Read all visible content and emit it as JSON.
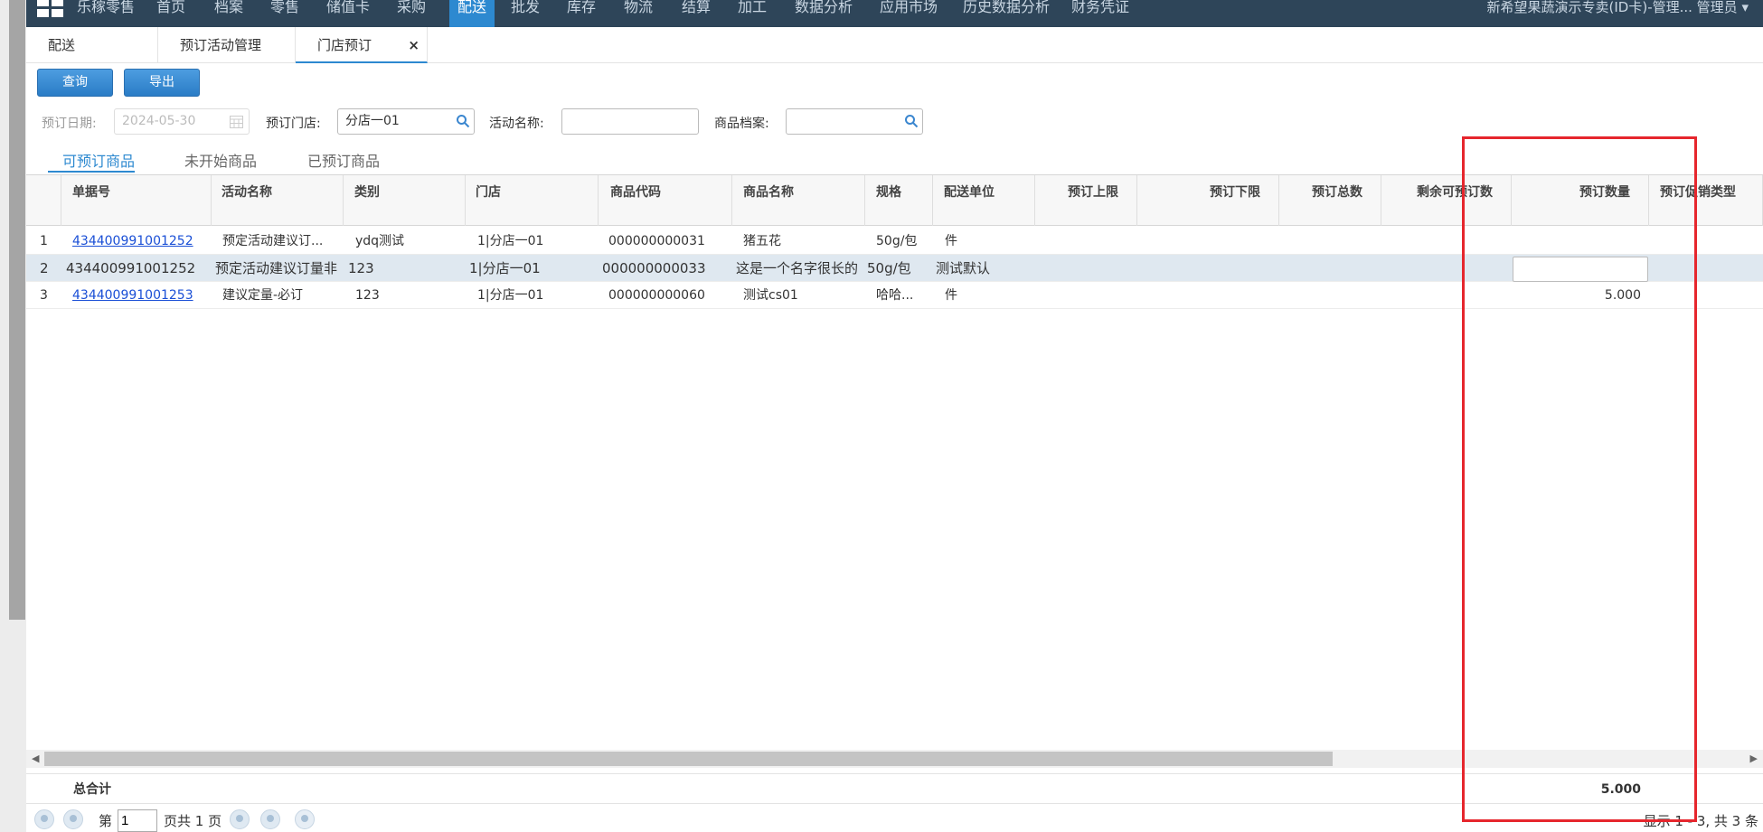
{
  "topnav": {
    "items": [
      "乐稼零售",
      "首页",
      "档案",
      "零售",
      "储值卡",
      "采购",
      "配送",
      "批发",
      "库存",
      "物流",
      "结算",
      "加工",
      "数据分析",
      "应用市场",
      "历史数据分析",
      "财务凭证"
    ],
    "active_index": 6,
    "user": "新希望果蔬演示专卖(ID卡)-管理...  管理员"
  },
  "tabs": [
    {
      "label": "配送"
    },
    {
      "label": "预订活动管理"
    },
    {
      "label": "门店预订",
      "close": "×"
    }
  ],
  "toolbar": {
    "query_label": "查询",
    "export_label": "导出"
  },
  "filters": {
    "date_label": "预订日期:",
    "date_value": "2024-05-30",
    "store_label": "预订门店:",
    "store_value": "分店一01",
    "activity_label": "活动名称:",
    "activity_value": "",
    "product_label": "商品档案:",
    "product_value": ""
  },
  "subtabs": [
    "可预订商品",
    "未开始商品",
    "已预订商品"
  ],
  "table": {
    "headers": [
      "单据号",
      "活动名称",
      "类别",
      "门店",
      "商品代码",
      "商品名称",
      "规格",
      "配送单位",
      "预订上限",
      "预订下限",
      "预订总数",
      "剩余可预订数",
      "预订数量",
      "预订促销类型"
    ],
    "rows": [
      {
        "num": "1",
        "doc": "434400991001252",
        "activity": "预定活动建议订...",
        "category": "ydq测试",
        "store": "1|分店一01",
        "code": "000000000031",
        "name": "猪五花",
        "spec": "50g/包",
        "unit": "件",
        "qty": ""
      },
      {
        "num": "2",
        "doc": "434400991001252",
        "activity": "预定活动建议订量非",
        "category": "123",
        "store": "1|分店一01",
        "code": "000000000033",
        "name": "这是一个名字很长的",
        "spec": "50g/包",
        "unit": "测试默认",
        "qty": ""
      },
      {
        "num": "3",
        "doc": "434400991001253",
        "activity": "建议定量-必订",
        "category": "123",
        "store": "1|分店一01",
        "code": "000000000060",
        "name": "测试cs01",
        "spec": "哈哈...",
        "unit": "件",
        "qty": "5.000"
      }
    ]
  },
  "totals": {
    "label": "总合计",
    "qty": "5.000"
  },
  "pager": {
    "page_prefix": "第",
    "page_value": "1",
    "page_suffix": "页共 1 页",
    "summary": "显示 1 - 3,  共 3 条"
  },
  "colors": {
    "nav_bg": "#2e4559",
    "accent": "#2d89d0",
    "highlight": "#e6262d",
    "link": "#1a4fd6"
  }
}
